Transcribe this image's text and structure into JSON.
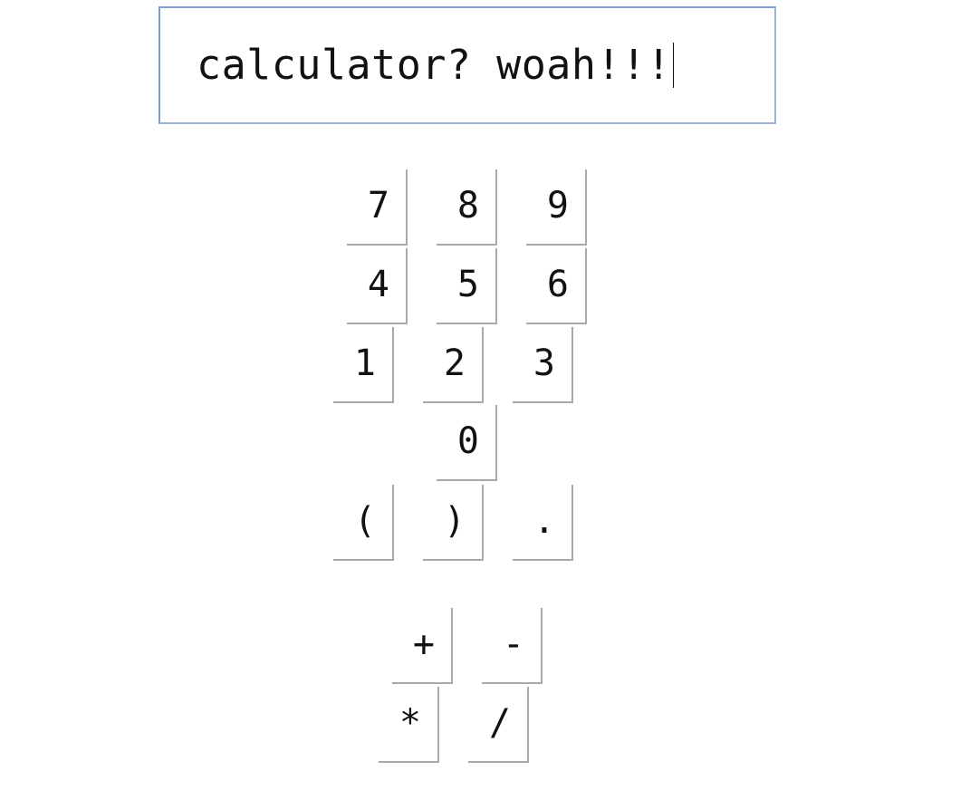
{
  "display": {
    "value": "calculator? woah!!!"
  },
  "keypad": {
    "k7": "7",
    "k8": "8",
    "k9": "9",
    "k4": "4",
    "k5": "5",
    "k6": "6",
    "k1": "1",
    "k2": "2",
    "k3": "3",
    "k0": "0",
    "lparen": "(",
    "rparen": ")",
    "dot": "."
  },
  "operators": {
    "plus": "+",
    "minus": "-",
    "times": "*",
    "divide": "/"
  }
}
